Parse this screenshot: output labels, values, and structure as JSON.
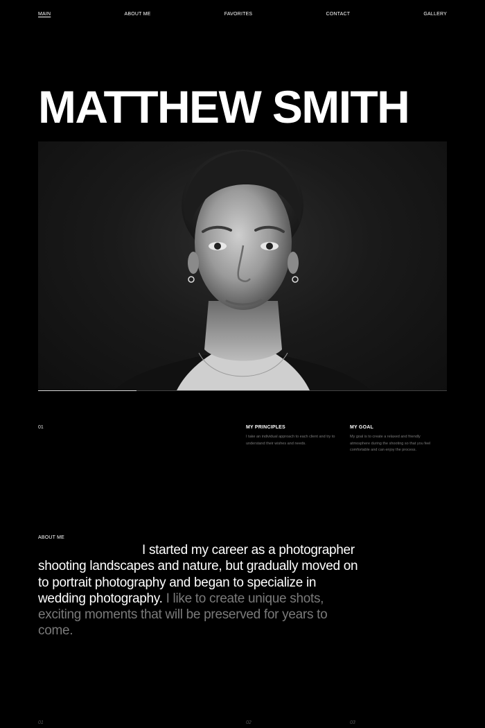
{
  "nav": {
    "items": [
      {
        "label": "MAIN",
        "active": true
      },
      {
        "label": "ABOUT ME"
      },
      {
        "label": "FAVORITES"
      },
      {
        "label": "CONTACT"
      },
      {
        "label": "GALLERY"
      }
    ]
  },
  "hero": {
    "title": "MATTHEW SMITH",
    "progress": 0.24
  },
  "info": {
    "index": "01",
    "principles": {
      "title": "MY PRINCIPLES",
      "text": "I take an individual approach to each client and try to understand their wishes and needs."
    },
    "goal": {
      "title": "MY GOAL",
      "text": "My goal is to create a relaxed and friendly atmosphere during the shooting so that you feel comfortable and can enjoy the process."
    }
  },
  "about": {
    "label": "ABOUT ME",
    "text_bright": "I started my career as a photographer shooting landscapes and nature, but gradually moved on to portrait photography and began to specialize in wedding photography.",
    "text_dim": "I like to create unique shots, exciting moments that will be preserved for years to come."
  },
  "footer": {
    "indices": [
      "01",
      "02",
      "03"
    ]
  },
  "colors": {
    "background": "#000000",
    "text": "#ffffff",
    "muted": "#7a7a7a"
  }
}
